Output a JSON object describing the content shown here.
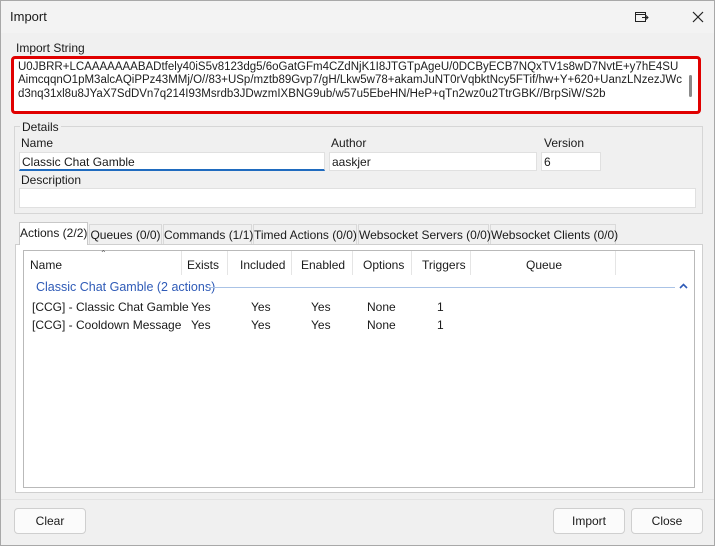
{
  "window": {
    "title": "Import"
  },
  "import_string": {
    "label": "Import String",
    "value": "U0JBRR+LCAAAAAAABADtfely40iS5v8123dg5/6oGatGFm4CZdNjK1I8JTGTpAgeU/0DCByECB7NQxTV1s8wD7NvtE+y7hE4SUAimcqqnO1pM3alcAQiPPz43MMj/O//83+USp/mztb89Gvp7/gH/Lkw5w78+akamJuNT0rVqbktNcy5FTif/hw+Y+620+UanzLNzezJWcd3nq31xl8u8JYaX7SdDVn7q214I93Msrdb3JDwzmIXBNG9ub/w57u5EbeHN/HeP+qTn2wz0u2TtrGBK//BrpSiW/S2b"
  },
  "details": {
    "group_label": "Details",
    "name_label": "Name",
    "name_value": "Classic Chat Gamble",
    "author_label": "Author",
    "author_value": "aaskjer",
    "version_label": "Version",
    "version_value": "6",
    "description_label": "Description",
    "description_value": ""
  },
  "tabs": [
    {
      "label": "Actions (2/2)",
      "active": true
    },
    {
      "label": "Queues (0/0)",
      "active": false
    },
    {
      "label": "Commands (1/1)",
      "active": false
    },
    {
      "label": "Timed Actions (0/0)",
      "active": false
    },
    {
      "label": "Websocket Servers (0/0)",
      "active": false
    },
    {
      "label": "Websocket Clients (0/0)",
      "active": false
    }
  ],
  "actions_table": {
    "columns": [
      "Name",
      "Exists",
      "Included",
      "Enabled",
      "Options",
      "Triggers",
      "Queue"
    ],
    "group_title": "Classic Chat Gamble (2 actions)",
    "rows": [
      [
        "[CCG] - Classic Chat Gamble",
        "Yes",
        "Yes",
        "Yes",
        "None",
        "1",
        ""
      ],
      [
        "[CCG] - Cooldown Message",
        "Yes",
        "Yes",
        "Yes",
        "None",
        "1",
        ""
      ]
    ]
  },
  "buttons": {
    "clear": "Clear",
    "import": "Import",
    "close": "Close"
  },
  "icons": {
    "restore": "restore-window-icon",
    "close": "close-icon",
    "sort": "sort-ascending-icon",
    "collapse": "chevron-up-icon"
  },
  "colors": {
    "accent": "#1f6bbf",
    "highlight_border": "#e00000",
    "group_title": "#2f5bb7"
  }
}
